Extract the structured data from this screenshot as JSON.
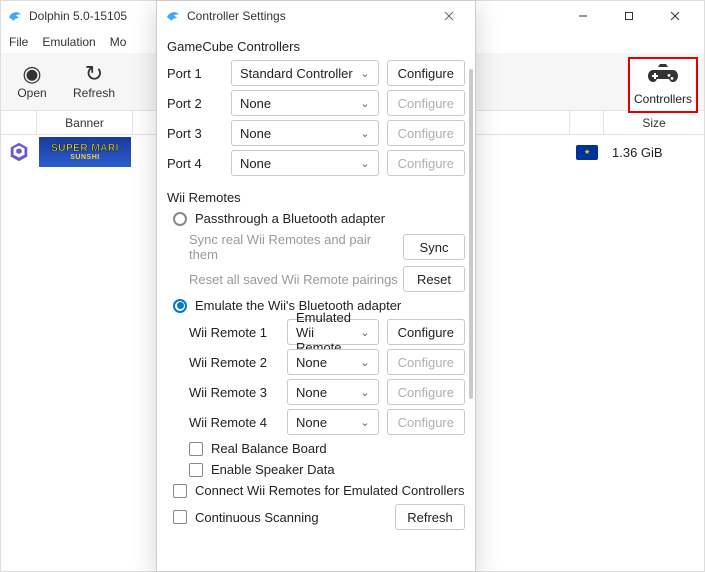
{
  "main": {
    "title": "Dolphin 5.0-15105",
    "menu": {
      "file": "File",
      "emulation": "Emulation",
      "movie_trunc": "Mo"
    },
    "toolbar": {
      "open": "Open",
      "refresh": "Refresh",
      "controllers": "Controllers"
    },
    "columns": {
      "banner": "Banner",
      "size": "Size"
    },
    "game": {
      "banner_l1": "SUPER MARI",
      "banner_l2": "SUNSHI",
      "size": "1.36 GiB"
    }
  },
  "modal": {
    "title": "Controller Settings",
    "gc_section": "GameCube Controllers",
    "ports": [
      {
        "label": "Port 1",
        "value": "Standard Controller",
        "configure": "Configure",
        "enabled": true
      },
      {
        "label": "Port 2",
        "value": "None",
        "configure": "Configure",
        "enabled": false
      },
      {
        "label": "Port 3",
        "value": "None",
        "configure": "Configure",
        "enabled": false
      },
      {
        "label": "Port 4",
        "value": "None",
        "configure": "Configure",
        "enabled": false
      }
    ],
    "wii_section": "Wii Remotes",
    "radio_passthrough": "Passthrough a Bluetooth adapter",
    "sync_desc": "Sync real Wii Remotes and pair them",
    "sync_btn": "Sync",
    "reset_desc": "Reset all saved Wii Remote pairings",
    "reset_btn": "Reset",
    "radio_emulate": "Emulate the Wii's Bluetooth adapter",
    "wiimotes": [
      {
        "label": "Wii Remote 1",
        "value": "Emulated Wii Remote",
        "configure": "Configure",
        "enabled": true
      },
      {
        "label": "Wii Remote 2",
        "value": "None",
        "configure": "Configure",
        "enabled": false
      },
      {
        "label": "Wii Remote 3",
        "value": "None",
        "configure": "Configure",
        "enabled": false
      },
      {
        "label": "Wii Remote 4",
        "value": "None",
        "configure": "Configure",
        "enabled": false
      }
    ],
    "check_balance": "Real Balance Board",
    "check_speaker": "Enable Speaker Data",
    "check_connect": "Connect Wii Remotes for Emulated Controllers",
    "check_scan": "Continuous Scanning",
    "refresh_btn": "Refresh"
  }
}
